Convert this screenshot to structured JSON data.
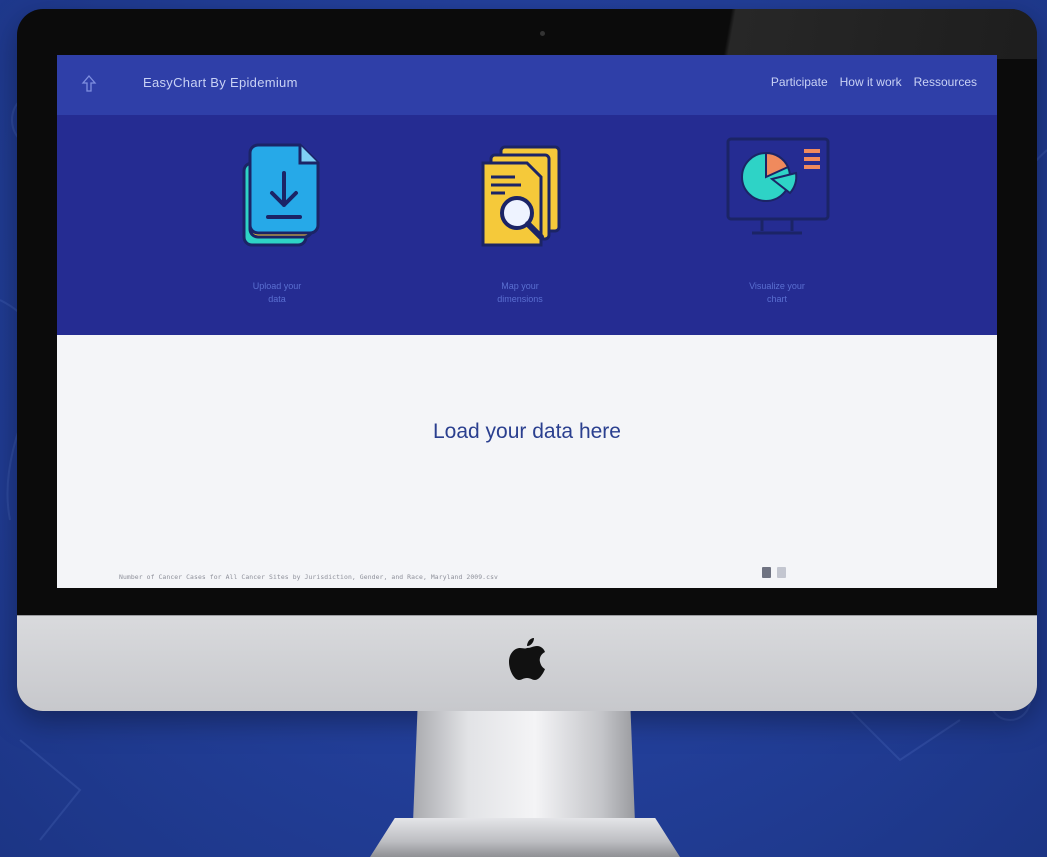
{
  "navbar": {
    "brand": "EasyChart By Epidemium",
    "links": [
      "Participate",
      "How it work",
      "Ressources"
    ]
  },
  "steps": [
    {
      "icon": "file-download-icon",
      "label": "Upload your\ndata"
    },
    {
      "icon": "document-search-icon",
      "label": "Map your\ndimensions"
    },
    {
      "icon": "pie-chart-monitor-icon",
      "label": "Visualize your\nchart"
    }
  ],
  "main": {
    "load_title": "Load your data here",
    "file_name": "Number of Cancer Cases for All Cancer Sites by Jurisdiction, Gender, and Race, Maryland 2009.csv"
  },
  "colors": {
    "navbar": "#2f3fa8",
    "hero": "#252c92",
    "accent_text": "#2a3f8f",
    "page_bg": "#24419e"
  }
}
